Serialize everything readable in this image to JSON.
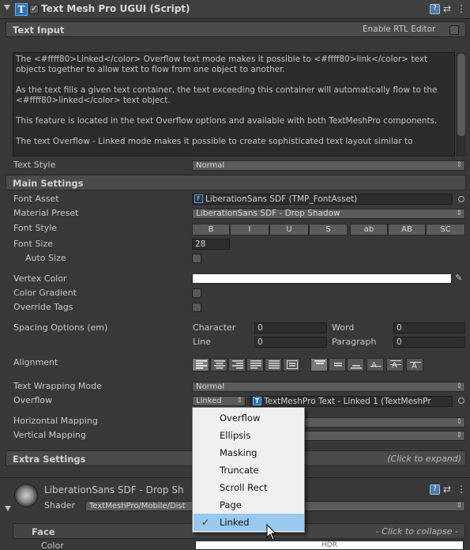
{
  "component": {
    "title": "Text Mesh Pro UGUI (Script)",
    "icon": "textmeshpro-icon",
    "enabled": true
  },
  "text_input": {
    "header": "Text Input",
    "rtl_label": "Enable RTL Editor",
    "rtl_enabled": false,
    "paragraphs": [
      "The <#ffff80>Linked</color> Overflow text mode makes it possible to <#ffff80>link</color> text objects together to allow text to flow from one object to another.",
      "As the text fills a given text container, the text exceeding this container will automatically flow to the <#ffff80>linked</color> text object.",
      "This feature is located in the text Overflow options and available with both TextMeshPro components.",
      "The text Overflow - Linked mode makes it possible to create sophisticated text layout similar to"
    ],
    "text_style_label": "Text Style",
    "text_style_value": "Normal"
  },
  "main_settings": {
    "header": "Main Settings",
    "font_asset_label": "Font Asset",
    "font_asset_value": "LiberationSans SDF (TMP_FontAsset)",
    "material_preset_label": "Material Preset",
    "material_preset_value": "LiberationSans SDF - Drop Shadow",
    "font_style_label": "Font Style",
    "font_style_buttons": [
      "B",
      "I",
      "U",
      "S",
      "ab",
      "AB",
      "SC"
    ],
    "font_size_label": "Font Size",
    "font_size_value": "28",
    "auto_size_label": "Auto Size",
    "vertex_color_label": "Vertex Color",
    "vertex_color": "#ffffff",
    "color_gradient_label": "Color Gradient",
    "override_tags_label": "Override Tags",
    "spacing_label": "Spacing Options (em)",
    "spacing": {
      "character_label": "Character",
      "character_value": "0",
      "word_label": "Word",
      "word_value": "0",
      "line_label": "Line",
      "line_value": "0",
      "paragraph_label": "Paragraph",
      "paragraph_value": "0"
    },
    "alignment_label": "Alignment",
    "wrapping_label": "Text Wrapping Mode",
    "wrapping_value": "Normal",
    "overflow_label": "Overflow",
    "overflow_value": "Linked",
    "linked_object_value": "TextMeshPro Text - Linked 1 (TextMeshPr",
    "horizontal_mapping_label": "Horizontal Mapping",
    "vertical_mapping_label": "Vertical Mapping"
  },
  "extra_settings": {
    "header": "Extra Settings",
    "hint": "(Click to expand)"
  },
  "material": {
    "name": "LiberationSans SDF - Drop Sh",
    "shader_label": "Shader",
    "shader_value": "TextMeshPro/Mobile/Dist",
    "face_label": "Face",
    "face_hint": "- Click to collapse -",
    "color_label": "Color",
    "hdr_label": "HDR"
  },
  "overflow_menu": {
    "items": [
      "Overflow",
      "Ellipsis",
      "Masking",
      "Truncate",
      "Scroll Rect",
      "Page",
      "Linked"
    ],
    "selected": "Linked"
  }
}
